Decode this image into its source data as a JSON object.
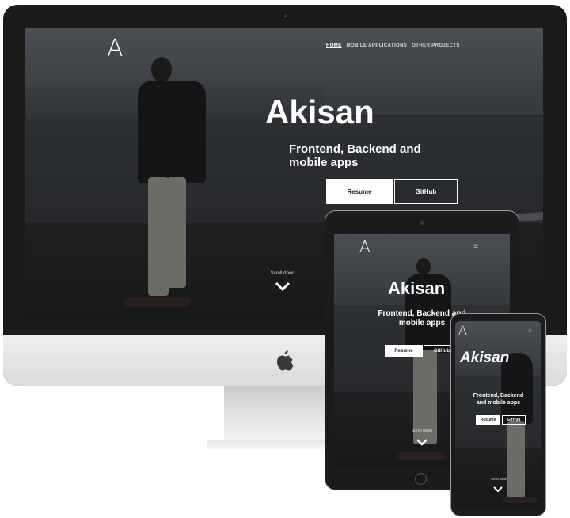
{
  "desktop": {
    "logo": "A",
    "nav": [
      "HOME",
      "MOBILE APPLICATIONS",
      "OTHER PROJECTS"
    ],
    "title": "Akisan",
    "subtitle_line1": "Frontend, Backend and",
    "subtitle_line2": "mobile apps",
    "resume_label": "Resume",
    "github_label": "GitHub",
    "scroll_label": "Scroll down",
    "chevron": "⌄",
    "apple_logo": ""
  },
  "tablet": {
    "logo": "A",
    "menu_icon": "≡",
    "title": "Akisan",
    "subtitle_line1": "Frontend, Backend and",
    "subtitle_line2": "mobile apps",
    "resume_label": "Resume",
    "github_label": "GitHub",
    "scroll_label": "Scroll down",
    "chevron": "⌄"
  },
  "phone": {
    "logo": "A",
    "menu_icon": "≡",
    "title": "Akisan",
    "subtitle_line1": "Frontend, Backend",
    "subtitle_line2": "and mobile apps",
    "resume_label": "Resume",
    "github_label": "GitHub",
    "scroll_label": "Scroll down",
    "chevron": "⌄"
  },
  "colors": {
    "device_bezel": "#1b1b1b",
    "monitor_chin": "#e3e4e6",
    "stand": "#d5d6d8",
    "accent": "#ffffff"
  }
}
